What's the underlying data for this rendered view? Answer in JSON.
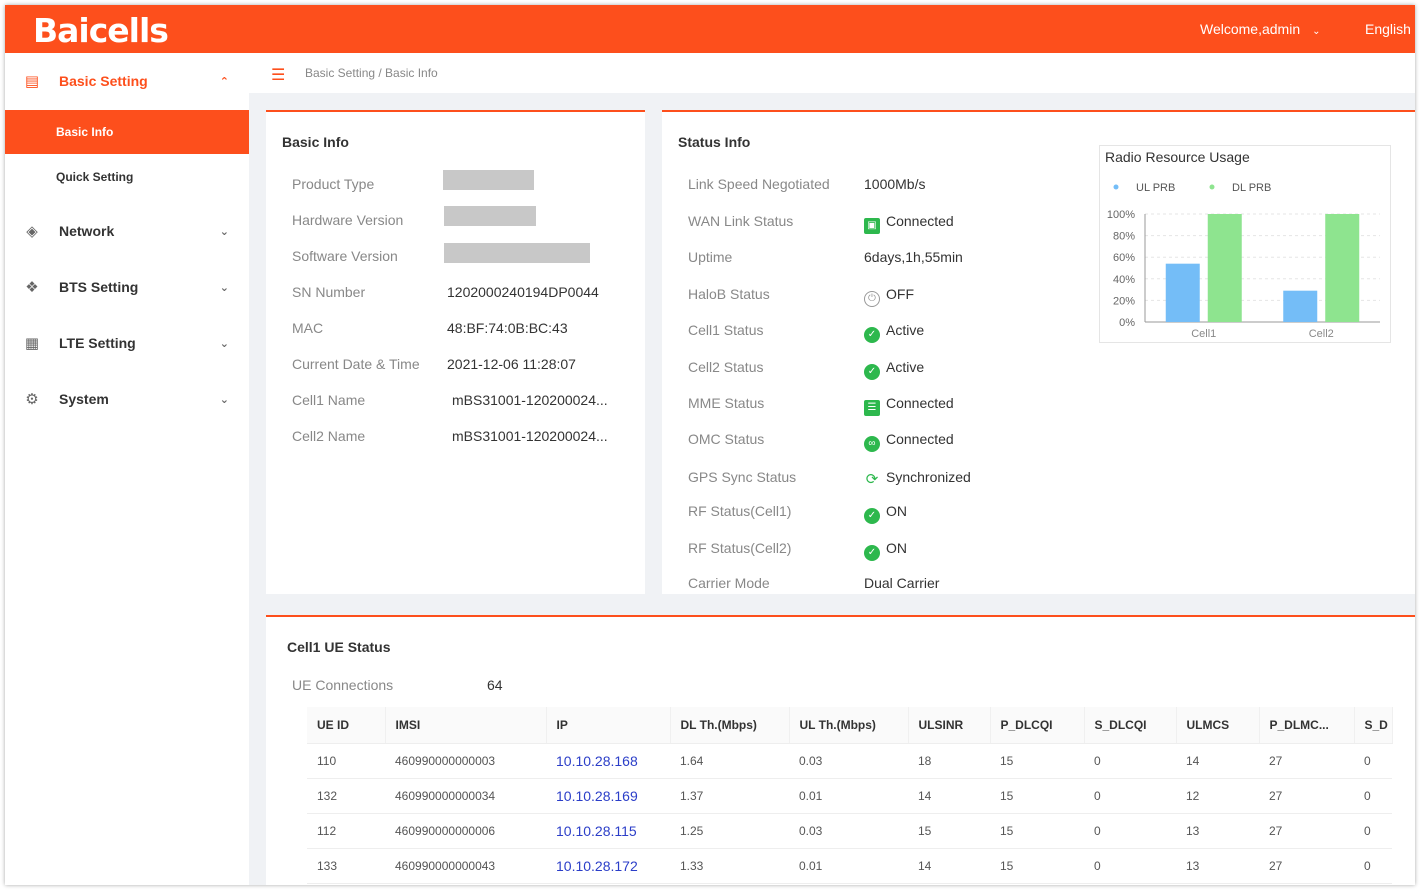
{
  "header": {
    "logo": "Baicells",
    "welcome": "Welcome,admin",
    "language": "English"
  },
  "sidebar": {
    "basic_setting": "Basic Setting",
    "basic_info": "Basic Info",
    "quick_setting": "Quick Setting",
    "network": "Network",
    "bts_setting": "BTS Setting",
    "lte_setting": "LTE Setting",
    "system": "System"
  },
  "breadcrumb": "Basic Setting / Basic Info",
  "basic_info": {
    "title": "Basic Info",
    "rows": [
      {
        "label": "Product Type",
        "value": ""
      },
      {
        "label": "Hardware Version",
        "value": ""
      },
      {
        "label": "Software Version",
        "value": ""
      },
      {
        "label": "SN Number",
        "value": "1202000240194DP0044"
      },
      {
        "label": "MAC",
        "value": "48:BF:74:0B:BC:43"
      },
      {
        "label": "Current Date & Time",
        "value": "2021-12-06 11:28:07"
      },
      {
        "label": "Cell1 Name",
        "value": "mBS31001-120200024..."
      },
      {
        "label": "Cell2 Name",
        "value": "mBS31001-120200024..."
      }
    ]
  },
  "status_info": {
    "title": "Status Info",
    "rows": [
      {
        "label": "Link Speed Negotiated",
        "value": "1000Mb/s",
        "icon": ""
      },
      {
        "label": "WAN Link Status",
        "value": "Connected",
        "icon": "monitor-icon"
      },
      {
        "label": "Uptime",
        "value": "6days,1h,55min",
        "icon": ""
      },
      {
        "label": "HaloB Status",
        "value": "OFF",
        "icon": "power-off-icon"
      },
      {
        "label": "Cell1 Status",
        "value": "Active",
        "icon": "cell-active-icon"
      },
      {
        "label": "Cell2 Status",
        "value": "Active",
        "icon": "cell-active-icon"
      },
      {
        "label": "MME Status",
        "value": "Connected",
        "icon": "server-icon"
      },
      {
        "label": "OMC Status",
        "value": "Connected",
        "icon": "link-icon"
      },
      {
        "label": "GPS Sync Status",
        "value": "Synchronized",
        "icon": "sync-icon"
      },
      {
        "label": "RF Status(Cell1)",
        "value": "ON",
        "icon": "rf-on-icon"
      },
      {
        "label": "RF Status(Cell2)",
        "value": "ON",
        "icon": "rf-on-icon"
      },
      {
        "label": "Carrier Mode",
        "value": "Dual Carrier",
        "icon": ""
      }
    ]
  },
  "chart_data": {
    "type": "bar",
    "title": "Radio Resource Usage",
    "categories": [
      "Cell1",
      "Cell2"
    ],
    "series": [
      {
        "name": "UL PRB",
        "values": [
          54,
          29
        ],
        "color": "#74bdf7"
      },
      {
        "name": "DL PRB",
        "values": [
          100,
          100
        ],
        "color": "#8ee48f"
      }
    ],
    "ylim": [
      0,
      100
    ],
    "yticks": [
      "0%",
      "20%",
      "40%",
      "60%",
      "80%",
      "100%"
    ],
    "legend": "top"
  },
  "ue_status": {
    "title": "Cell1 UE Status",
    "connections_label": "UE Connections",
    "connections_value": "64",
    "columns": [
      "UE ID",
      "IMSI",
      "IP",
      "DL Th.(Mbps)",
      "UL Th.(Mbps)",
      "ULSINR",
      "P_DLCQI",
      "S_DLCQI",
      "ULMCS",
      "P_DLMC...",
      "S_D"
    ],
    "rows": [
      [
        "110",
        "460990000000003",
        "10.10.28.168",
        "1.64",
        "0.03",
        "18",
        "15",
        "0",
        "14",
        "27",
        "0"
      ],
      [
        "132",
        "460990000000034",
        "10.10.28.169",
        "1.37",
        "0.01",
        "14",
        "15",
        "0",
        "12",
        "27",
        "0"
      ],
      [
        "112",
        "460990000000006",
        "10.10.28.115",
        "1.25",
        "0.03",
        "15",
        "15",
        "0",
        "13",
        "27",
        "0"
      ],
      [
        "133",
        "460990000000043",
        "10.10.28.172",
        "1.33",
        "0.01",
        "14",
        "15",
        "0",
        "13",
        "27",
        "0"
      ]
    ]
  }
}
